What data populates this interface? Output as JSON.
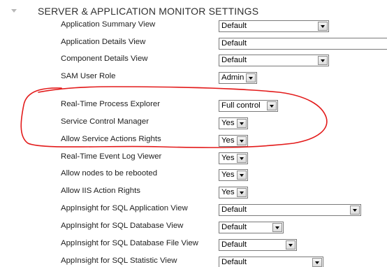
{
  "section": {
    "title": "SERVER & APPLICATION MONITOR SETTINGS"
  },
  "settings": [
    {
      "label": "Application Summary View",
      "value": "Default"
    },
    {
      "label": "Application Details View",
      "value": "Default"
    },
    {
      "label": "Component Details View",
      "value": "Default"
    },
    {
      "label": "SAM User Role",
      "value": "Admin"
    },
    {
      "label": "Real-Time Process Explorer",
      "value": "Full control"
    },
    {
      "label": "Service Control Manager",
      "value": "Yes"
    },
    {
      "label": "Allow Service Actions Rights",
      "value": "Yes"
    },
    {
      "label": "Real-Time Event Log Viewer",
      "value": "Yes"
    },
    {
      "label": "Allow nodes to be rebooted",
      "value": "Yes"
    },
    {
      "label": "Allow IIS Action Rights",
      "value": "Yes"
    },
    {
      "label": "AppInsight for SQL Application View",
      "value": "Default"
    },
    {
      "label": "AppInsight for SQL Database View",
      "value": "Default"
    },
    {
      "label": "AppInsight for SQL Database File View",
      "value": "Default"
    },
    {
      "label": "AppInsight for SQL Statistic View",
      "value": "Default"
    }
  ],
  "annotation": {
    "color": "#e31b1b"
  }
}
